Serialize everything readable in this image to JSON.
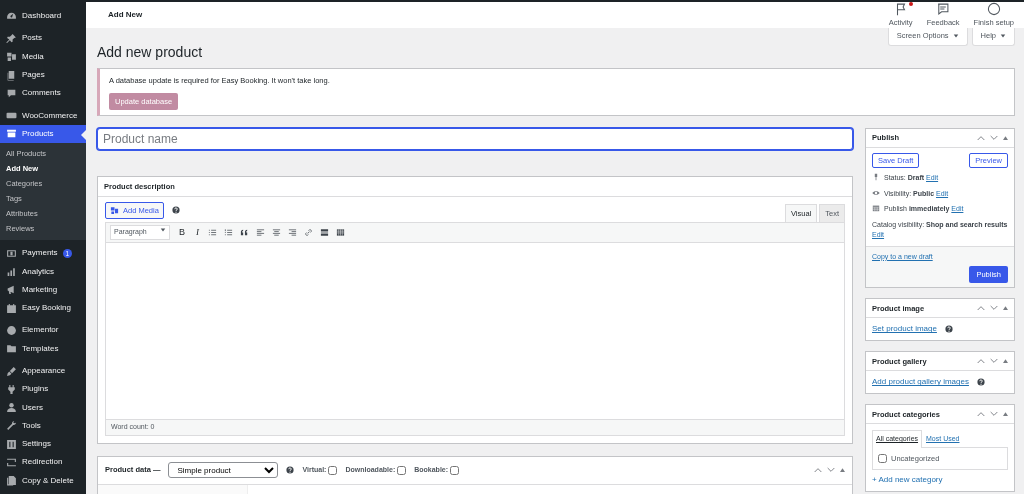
{
  "sidebar": {
    "groups": [
      [
        {
          "label": "Dashboard",
          "selected": false
        }
      ],
      [
        {
          "label": "Posts",
          "selected": false
        },
        {
          "label": "Media",
          "selected": false
        },
        {
          "label": "Pages",
          "selected": false
        },
        {
          "label": "Comments",
          "selected": false
        }
      ],
      [
        {
          "label": "WooCommerce",
          "selected": false
        },
        {
          "label": "Products",
          "selected": true,
          "children": [
            {
              "label": "All Products",
              "selected": false
            },
            {
              "label": "Add New",
              "selected": true
            },
            {
              "label": "Categories",
              "selected": false
            },
            {
              "label": "Tags",
              "selected": false
            },
            {
              "label": "Attributes",
              "selected": false
            },
            {
              "label": "Reviews",
              "selected": false
            }
          ]
        }
      ],
      [
        {
          "label": "Payments",
          "selected": false,
          "badge": "1"
        },
        {
          "label": "Analytics",
          "selected": false
        },
        {
          "label": "Marketing",
          "selected": false
        },
        {
          "label": "Easy Booking",
          "selected": false
        }
      ],
      [
        {
          "label": "Elementor",
          "selected": false
        },
        {
          "label": "Templates",
          "selected": false
        }
      ],
      [
        {
          "label": "Appearance",
          "selected": false
        },
        {
          "label": "Plugins",
          "selected": false
        },
        {
          "label": "Users",
          "selected": false
        },
        {
          "label": "Tools",
          "selected": false
        },
        {
          "label": "Settings",
          "selected": false
        },
        {
          "label": "Redirection",
          "selected": false
        },
        {
          "label": "Copy & Delete",
          "selected": false
        }
      ]
    ]
  },
  "header": {
    "title": "Add New",
    "actions": [
      {
        "label": "Activity",
        "notification": true
      },
      {
        "label": "Feedback",
        "notification": false
      },
      {
        "label": "Finish setup",
        "notification": false
      }
    ]
  },
  "screen_tabs": [
    "Screen Options",
    "Help"
  ],
  "page_title": "Add new product",
  "notice": {
    "message": "A database update is required for Easy Booking. It won't take long.",
    "button": "Update database"
  },
  "product_name": {
    "placeholder": "Product name"
  },
  "description": {
    "title": "Product description",
    "add_media": "Add Media",
    "tabs": [
      {
        "label": "Visual",
        "selected": true
      },
      {
        "label": "Text",
        "selected": false
      }
    ],
    "format": "Paragraph",
    "glyphs": [
      "B",
      "I"
    ],
    "word_count": "Word count: 0"
  },
  "product_data": {
    "title": "Product data —",
    "type": "Simple product",
    "options": [
      {
        "label": "Virtual:",
        "checked": false
      },
      {
        "label": "Downloadable:",
        "checked": false
      },
      {
        "label": "Bookable:",
        "checked": false
      }
    ]
  },
  "publish": {
    "title": "Publish",
    "save_draft": "Save Draft",
    "preview": "Preview",
    "lines": [
      {
        "text": "Status: **Draft**",
        "link": "Edit"
      },
      {
        "text": "Visibility: **Public**",
        "link": "Edit"
      },
      {
        "text": "Publish **immediately**",
        "link": "Edit"
      },
      {
        "text": "Catalog visibility: **Shop and search results**",
        "link": "Edit"
      }
    ],
    "copy_link": "Copy to a new draft",
    "publish_button": "Publish"
  },
  "product_image": {
    "title": "Product image",
    "link": "Set product image"
  },
  "product_gallery": {
    "title": "Product gallery",
    "link": "Add product gallery images"
  },
  "product_categories": {
    "title": "Product categories",
    "tabs": [
      {
        "label": "All categories",
        "selected": true
      },
      {
        "label": "Most Used",
        "selected": false
      }
    ],
    "items": [
      {
        "label": "Uncategorized",
        "checked": false
      }
    ],
    "add_link": "+ Add new category"
  }
}
